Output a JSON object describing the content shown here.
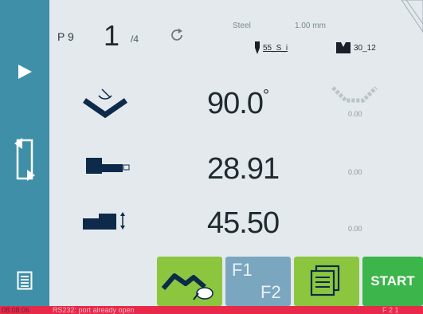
{
  "header": {
    "program_label": "P 9",
    "step_current": "1",
    "step_total": "/4",
    "material": "Steel",
    "thickness": "1.00 mm",
    "punch_tool": "55_S_i",
    "die_tool": "30_12"
  },
  "rows": {
    "angle": {
      "value": "90.0",
      "unit": "°",
      "correction": "0.00"
    },
    "backgauge_x": {
      "value": "28.91",
      "correction": "0.00"
    },
    "backgauge_r": {
      "value": "45.50",
      "correction": "0.00"
    }
  },
  "toolbar": {
    "f1_label": "F1",
    "f2_label": "F2",
    "start_label": "START"
  },
  "status": {
    "time": "08:08:06",
    "message": "RS232: port already open",
    "right_text": "F 2 1"
  },
  "colors": {
    "sidebar": "#3f8fa8",
    "green_button": "#8cc63f",
    "start_button": "#3cb54a",
    "function_button": "#7aa6bf",
    "status_bar": "#e8294a"
  }
}
